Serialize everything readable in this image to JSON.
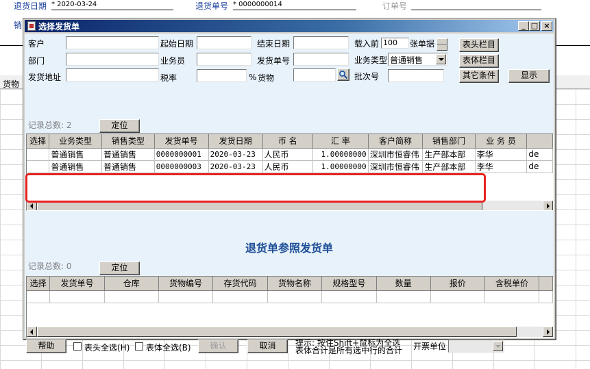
{
  "background": {
    "return_date_label": "退货日期",
    "return_date_value": "* 2020-03-24",
    "return_no_label": "退货单号",
    "return_no_value": "* 0000000014",
    "order_no_label": "订单号",
    "sales_label_cut": "销",
    "goods_label_cut": "货物"
  },
  "dialog": {
    "title": "选择发货单",
    "minimize": "_",
    "maximize": "□",
    "close": "×"
  },
  "filters": {
    "customer_label": "客户",
    "start_date_label": "起始日期",
    "end_date_label": "结束日期",
    "load_before_label": "载入前",
    "load_count_value": "100",
    "load_unit_label": "张单据",
    "department_label": "部门",
    "salesperson_label": "业务员",
    "ship_no_label": "发货单号",
    "biz_type_label": "业务类型",
    "biz_type_value": "普通销售",
    "ship_addr_label": "发货地址",
    "tax_rate_label": "税率",
    "percent_label": "%",
    "goods_label": "货物",
    "batch_label": "批次号"
  },
  "buttons": {
    "header_cols": "表头栏目",
    "body_cols": "表体栏目",
    "other_conditions": "其它条件",
    "display": "显示",
    "locate1": "定位",
    "locate2": "定位",
    "help": "帮助",
    "confirm": "确认",
    "cancel": "取消"
  },
  "top_grid": {
    "record_count": "记录总数: 2",
    "columns": [
      "选择",
      "业务类型",
      "销售类型",
      "发货单号",
      "发货日期",
      "币 名",
      "汇 率",
      "客户简称",
      "销售部门",
      "业 务 员",
      ""
    ],
    "rows": [
      [
        "",
        "普通销售",
        "普通销售",
        "0000000001",
        "2020-03-23",
        "人民币",
        "1.00000000",
        "深圳市恒睿伟",
        "生产部本部",
        "李华",
        "de"
      ],
      [
        "",
        "普通销售",
        "普通销售",
        "0000000003",
        "2020-03-23",
        "人民币",
        "1.00000000",
        "深圳市恒睿伟",
        "生产部本部",
        "李华",
        "de"
      ]
    ]
  },
  "section_title": "退货单参照发货单",
  "bottom_grid": {
    "record_count": "记录总数: 0",
    "columns": [
      "选择",
      "发货单号",
      "仓库",
      "货物编号",
      "存货代码",
      "货物名称",
      "规格型号",
      "数量",
      "报价",
      "含税单价",
      ""
    ]
  },
  "footer": {
    "header_select_all": "表头全选(H)",
    "body_select_all": "表体全选(B)",
    "hint_line1": "提示: 按住Shift+鼠标为全选",
    "hint_line2": "表体合计是所有选中行的合计",
    "invoice_unit_label": "开票单位",
    "invoice_unit_value": ""
  },
  "colors": {
    "title_start": "#0a246a",
    "title_end": "#a6caf0",
    "panel_bg": "#e8f2fb",
    "section_title": "#1e4f96",
    "highlight": "#e8221e"
  },
  "icons": {
    "goods_lookup": "magnifier-icon"
  }
}
